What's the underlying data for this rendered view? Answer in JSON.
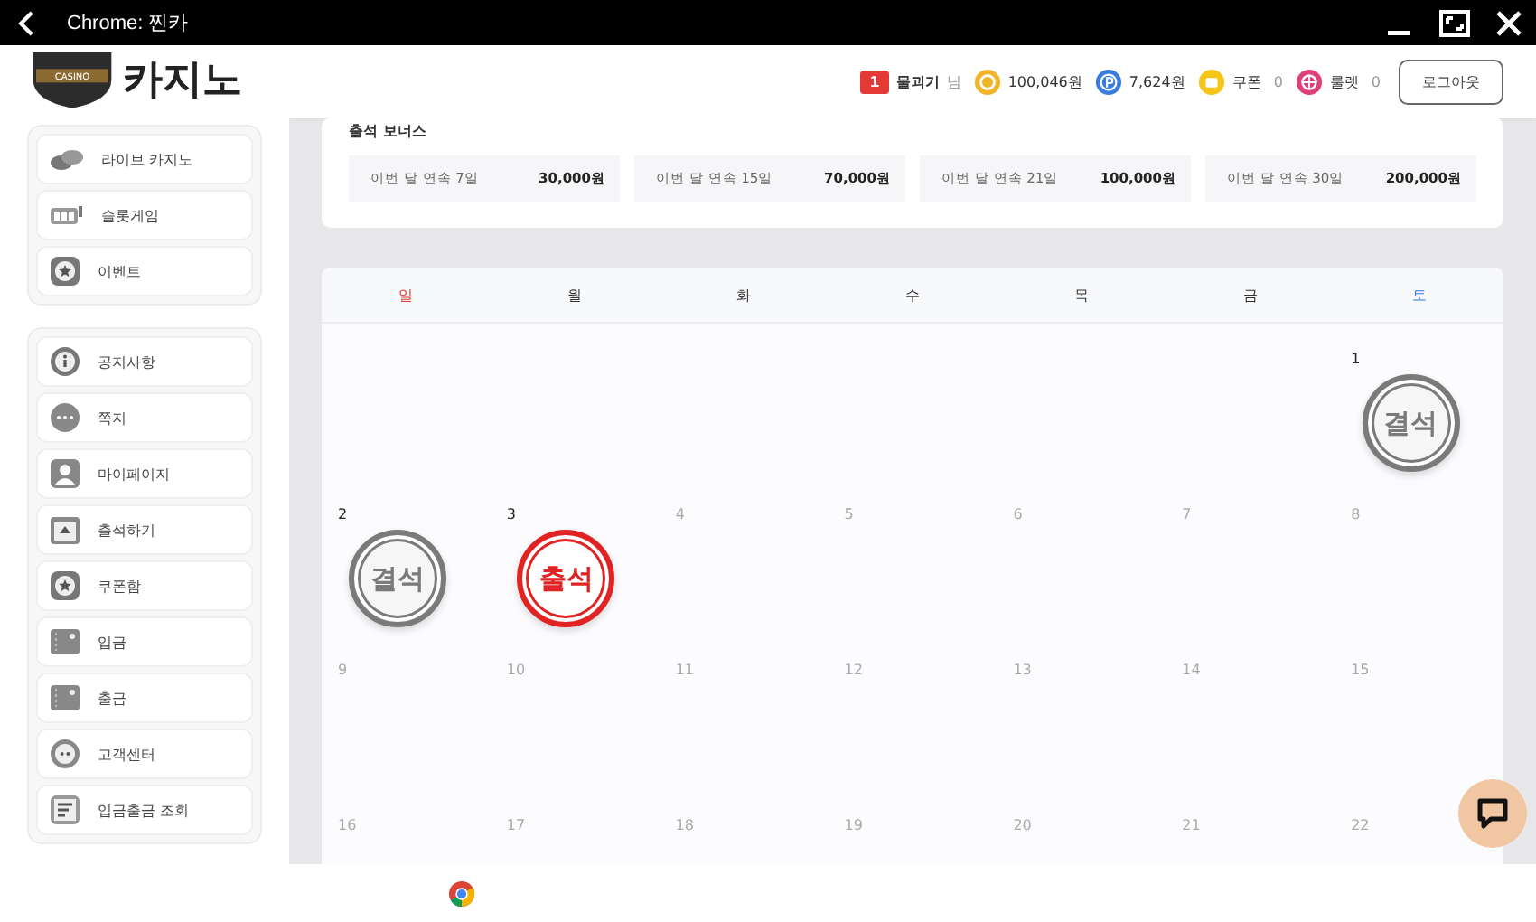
{
  "window": {
    "title": "Chrome: 찐카"
  },
  "logo": {
    "badge": "CASINO",
    "text": "카지노"
  },
  "header": {
    "level_badge": "1",
    "username": "물괴기",
    "honorific": "님",
    "money": "100,046원",
    "points": "7,624원",
    "coupon_label": "쿠폰",
    "coupon_count": "0",
    "roulette_label": "룰렛",
    "roulette_count": "0",
    "logout": "로그아웃"
  },
  "sidebar": {
    "groups": [
      [
        {
          "label": "라이브 카지노",
          "kind": "chips"
        },
        {
          "label": "슬롯게임",
          "kind": "slot"
        },
        {
          "label": "이벤트",
          "kind": "star"
        }
      ],
      [
        {
          "label": "공지사항",
          "kind": "info"
        },
        {
          "label": "쪽지",
          "kind": "chat"
        },
        {
          "label": "마이페이지",
          "kind": "user"
        },
        {
          "label": "출석하기",
          "kind": "calendar"
        },
        {
          "label": "쿠폰함",
          "kind": "star"
        },
        {
          "label": "입금",
          "kind": "wallet"
        },
        {
          "label": "출금",
          "kind": "wallet"
        },
        {
          "label": "고객센터",
          "kind": "support"
        },
        {
          "label": "입금출금 조회",
          "kind": "list"
        }
      ]
    ]
  },
  "bonus": {
    "title": "출석 보너스",
    "items": [
      {
        "label": "이번 달 연속 7일",
        "amount": "30,000원"
      },
      {
        "label": "이번 달 연속 15일",
        "amount": "70,000원"
      },
      {
        "label": "이번 달 연속 21일",
        "amount": "100,000원"
      },
      {
        "label": "이번 달 연속 30일",
        "amount": "200,000원"
      }
    ]
  },
  "calendar": {
    "weekdays": [
      {
        "label": "일",
        "kind": "sunday"
      },
      {
        "label": "월",
        "kind": "weekday"
      },
      {
        "label": "화",
        "kind": "weekday"
      },
      {
        "label": "수",
        "kind": "weekday"
      },
      {
        "label": "목",
        "kind": "weekday"
      },
      {
        "label": "금",
        "kind": "weekday"
      },
      {
        "label": "토",
        "kind": "saturday"
      }
    ],
    "days": [
      {
        "day": "1",
        "past": true,
        "stamp": "결석",
        "present": false
      },
      {
        "day": "2",
        "past": true,
        "stamp": "결석",
        "present": false
      },
      {
        "day": "3",
        "past": true,
        "stamp": "출석",
        "present": true
      },
      {
        "day": "4",
        "past": false
      },
      {
        "day": "5",
        "past": false
      },
      {
        "day": "6",
        "past": false
      },
      {
        "day": "7",
        "past": false
      },
      {
        "day": "8",
        "past": false
      },
      {
        "day": "9",
        "past": false
      },
      {
        "day": "10",
        "past": false
      },
      {
        "day": "11",
        "past": false
      },
      {
        "day": "12",
        "past": false
      },
      {
        "day": "13",
        "past": false
      },
      {
        "day": "14",
        "past": false
      },
      {
        "day": "15",
        "past": false
      },
      {
        "day": "16",
        "past": false
      },
      {
        "day": "17",
        "past": false
      },
      {
        "day": "18",
        "past": false
      },
      {
        "day": "19",
        "past": false
      },
      {
        "day": "20",
        "past": false
      },
      {
        "day": "21",
        "past": false
      },
      {
        "day": "22",
        "past": false
      }
    ]
  }
}
